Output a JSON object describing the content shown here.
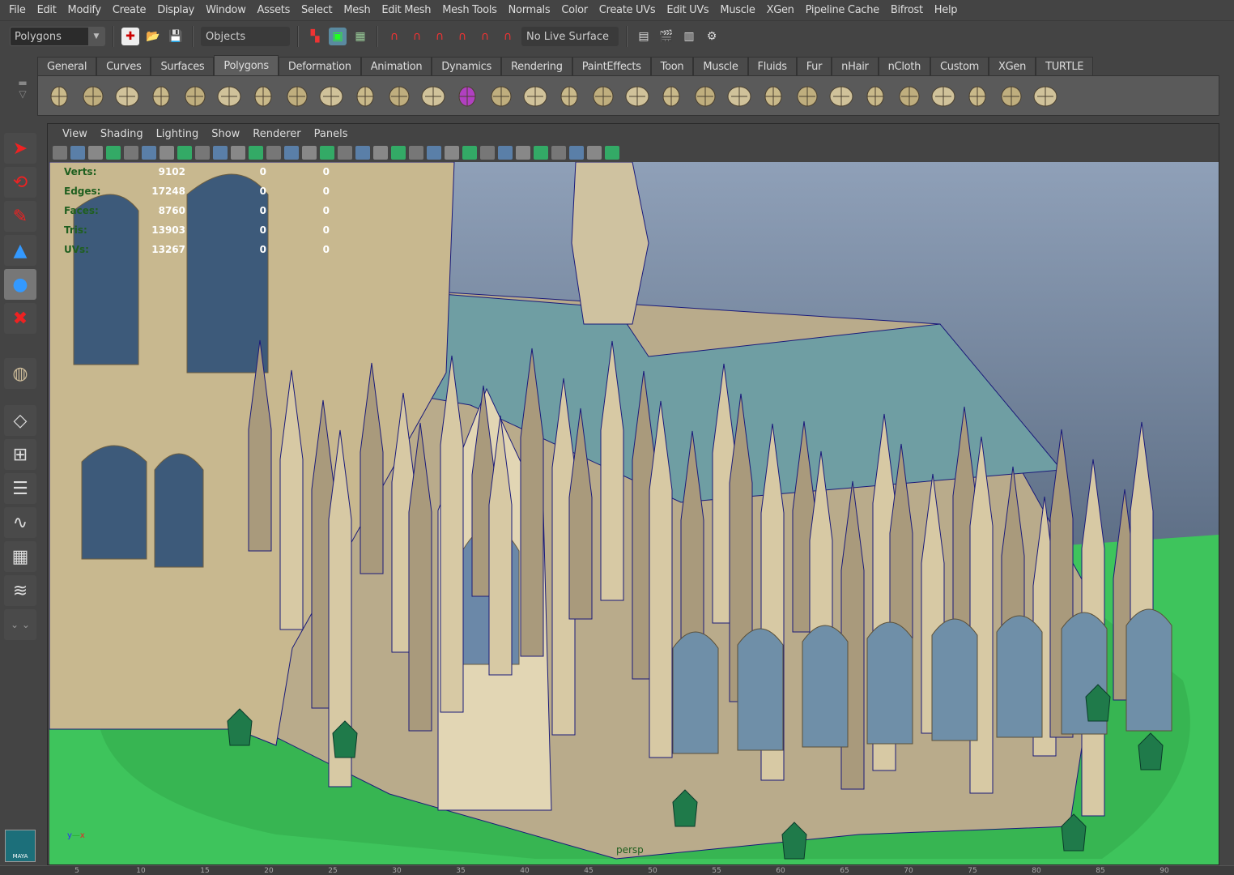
{
  "menubar": [
    "File",
    "Edit",
    "Modify",
    "Create",
    "Display",
    "Window",
    "Assets",
    "Select",
    "Mesh",
    "Edit Mesh",
    "Mesh Tools",
    "Normals",
    "Color",
    "Create UVs",
    "Edit UVs",
    "Muscle",
    "XGen",
    "Pipeline Cache",
    "Bifrost",
    "Help"
  ],
  "status": {
    "mode": "Polygons",
    "selection_mask": "Objects",
    "live_surface": "No Live Surface"
  },
  "shelf_tabs": [
    "General",
    "Curves",
    "Surfaces",
    "Polygons",
    "Deformation",
    "Animation",
    "Dynamics",
    "Rendering",
    "PaintEffects",
    "Toon",
    "Muscle",
    "Fluids",
    "Fur",
    "nHair",
    "nCloth",
    "Custom",
    "XGen",
    "TURTLE"
  ],
  "active_tab": "Polygons",
  "shelf_icons": [
    "poly-sphere-icon",
    "poly-cube-icon",
    "poly-cylinder-icon",
    "poly-cone-icon",
    "poly-plane-icon",
    "poly-torus-icon",
    "poly-pyramid-icon",
    "poly-pipe-icon",
    "combine-icon",
    "separate-icon",
    "smooth-icon",
    "smooth-proxy-icon",
    "sculpt-icon",
    "mirror-icon",
    "cut-faces-icon",
    "extrude-icon",
    "bridge-icon",
    "append-icon",
    "bevel-icon",
    "merge-icon",
    "split-icon",
    "insert-edgeloop-icon",
    "offset-edgeloop-icon",
    "wedge-icon",
    "poke-icon",
    "planar-uv-icon",
    "cylindrical-uv-icon",
    "spherical-uv-icon",
    "automatic-uv-icon",
    "uv-editor-icon"
  ],
  "panel_menu": [
    "View",
    "Shading",
    "Lighting",
    "Show",
    "Renderer",
    "Panels"
  ],
  "hud": [
    {
      "label": "Verts:",
      "values": [
        "9102",
        "0",
        "0"
      ]
    },
    {
      "label": "Edges:",
      "values": [
        "17248",
        "0",
        "0"
      ]
    },
    {
      "label": "Faces:",
      "values": [
        "8760",
        "0",
        "0"
      ]
    },
    {
      "label": "Tris:",
      "values": [
        "13903",
        "0",
        "0"
      ]
    },
    {
      "label": "UVs:",
      "values": [
        "13267",
        "0",
        "0"
      ]
    }
  ],
  "camera": "persp",
  "axis": {
    "y": "y",
    "x": "x"
  },
  "logo": "MAYA",
  "timeline_ticks": [
    "5",
    "10",
    "15",
    "20",
    "25",
    "30",
    "35",
    "40",
    "45",
    "50",
    "55",
    "60",
    "65",
    "70",
    "75",
    "80",
    "85",
    "90"
  ],
  "colors": {
    "ground": "#3ec45c",
    "roof": "#6f9ea3",
    "stone": "#d9cba8",
    "wire": "#1a1a7a"
  }
}
